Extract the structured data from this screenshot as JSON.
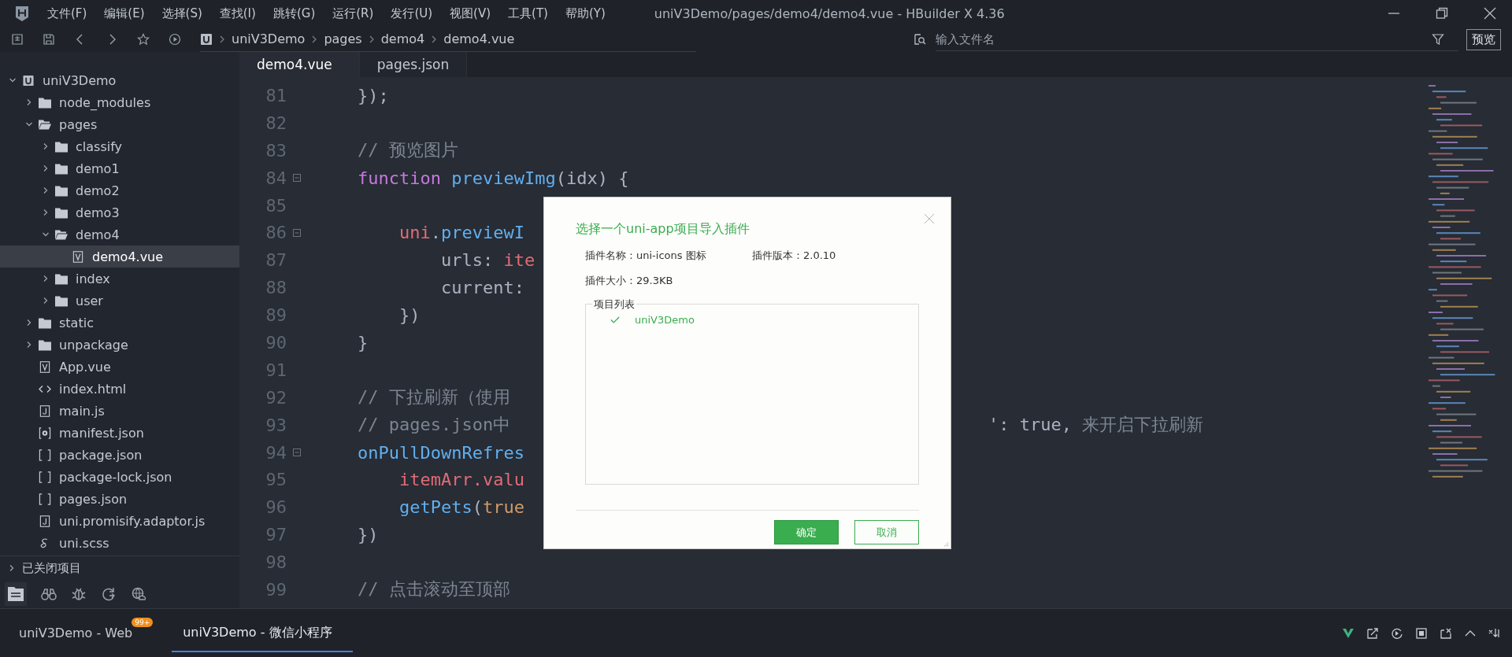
{
  "window": {
    "title": "uniV3Demo/pages/demo4/demo4.vue - HBuilder X 4.36"
  },
  "menu": [
    "文件(F)",
    "编辑(E)",
    "选择(S)",
    "查找(I)",
    "跳转(G)",
    "运行(R)",
    "发行(U)",
    "视图(V)",
    "工具(T)",
    "帮助(Y)"
  ],
  "breadcrumb": [
    "uniV3Demo",
    "pages",
    "demo4",
    "demo4.vue"
  ],
  "file_search": {
    "placeholder": "输入文件名"
  },
  "preview_button": "预览",
  "editor_tabs": [
    {
      "label": "demo4.vue",
      "selected": true
    },
    {
      "label": "pages.json",
      "selected": false
    }
  ],
  "tree": [
    {
      "label": "uniV3Demo",
      "kind": "project",
      "expanded": true,
      "selected": false,
      "children": [
        {
          "label": "node_modules",
          "kind": "folder",
          "expanded": false,
          "selected": false
        },
        {
          "label": "pages",
          "kind": "folder",
          "expanded": true,
          "selected": false,
          "children": [
            {
              "label": "classify",
              "kind": "folder",
              "expanded": false,
              "selected": false
            },
            {
              "label": "demo1",
              "kind": "folder",
              "expanded": false,
              "selected": false
            },
            {
              "label": "demo2",
              "kind": "folder",
              "expanded": false,
              "selected": false
            },
            {
              "label": "demo3",
              "kind": "folder",
              "expanded": false,
              "selected": false
            },
            {
              "label": "demo4",
              "kind": "folder",
              "expanded": true,
              "selected": false,
              "children": [
                {
                  "label": "demo4.vue",
                  "kind": "vue",
                  "selected": true
                }
              ]
            },
            {
              "label": "index",
              "kind": "folder",
              "expanded": false,
              "selected": false
            },
            {
              "label": "user",
              "kind": "folder",
              "expanded": false,
              "selected": false
            }
          ]
        },
        {
          "label": "static",
          "kind": "folder",
          "expanded": false,
          "selected": false
        },
        {
          "label": "unpackage",
          "kind": "folder",
          "expanded": false,
          "selected": false
        },
        {
          "label": "App.vue",
          "kind": "vue",
          "selected": false
        },
        {
          "label": "index.html",
          "kind": "html",
          "selected": false
        },
        {
          "label": "main.js",
          "kind": "js",
          "selected": false
        },
        {
          "label": "manifest.json",
          "kind": "settings",
          "selected": false
        },
        {
          "label": "package.json",
          "kind": "json",
          "selected": false
        },
        {
          "label": "package-lock.json",
          "kind": "json",
          "selected": false
        },
        {
          "label": "pages.json",
          "kind": "json",
          "selected": false
        },
        {
          "label": "uni.promisify.adaptor.js",
          "kind": "js",
          "selected": false
        },
        {
          "label": "uni.scss",
          "kind": "scss",
          "selected": false
        }
      ]
    }
  ],
  "closed_projects": {
    "label": "已关闭项目",
    "expanded": false
  },
  "code": [
    {
      "number": "81",
      "fold": false,
      "tokens": [
        {
          "text": "});",
          "kind": "plain"
        }
      ]
    },
    {
      "number": "82",
      "fold": false
    },
    {
      "number": "83",
      "fold": false,
      "tokens": [
        {
          "text": "// 预览图片",
          "kind": "comment"
        }
      ]
    },
    {
      "number": "84",
      "fold": true,
      "tokens": [
        {
          "text": "function ",
          "kind": "keyword"
        },
        {
          "text": "previewImg",
          "kind": "func"
        },
        {
          "text": "(idx) {",
          "kind": "plain"
        }
      ]
    },
    {
      "number": "85",
      "fold": false
    },
    {
      "number": "86",
      "fold": true,
      "tokens": [
        {
          "text": "    uni",
          "kind": "var"
        },
        {
          "text": ".",
          "kind": "plain"
        },
        {
          "text": "previewI",
          "kind": "func"
        }
      ]
    },
    {
      "number": "87",
      "fold": false,
      "tokens": [
        {
          "text": "        urls: ",
          "kind": "plain"
        },
        {
          "text": "ite",
          "kind": "var"
        }
      ]
    },
    {
      "number": "88",
      "fold": false,
      "tokens": [
        {
          "text": "        current:",
          "kind": "plain"
        }
      ]
    },
    {
      "number": "89",
      "fold": false,
      "tokens": [
        {
          "text": "    })",
          "kind": "plain"
        }
      ]
    },
    {
      "number": "90",
      "fold": false,
      "tokens": [
        {
          "text": "}",
          "kind": "plain"
        }
      ]
    },
    {
      "number": "91",
      "fold": false
    },
    {
      "number": "92",
      "fold": false,
      "tokens": [
        {
          "text": "// 下拉刷新（使用",
          "kind": "comment"
        }
      ]
    },
    {
      "number": "93",
      "fold": false,
      "tokens": [
        {
          "text": "// pages.json中",
          "kind": "comment"
        }
      ],
      "tail": [
        {
          "text": "': true, ",
          "kind": "plain"
        },
        {
          "text": "来开启下拉刷新",
          "kind": "comment"
        }
      ]
    },
    {
      "number": "94",
      "fold": true,
      "tokens": [
        {
          "text": "onPullDownRefres",
          "kind": "func"
        }
      ]
    },
    {
      "number": "95",
      "fold": false,
      "tokens": [
        {
          "text": "    itemArr.valu",
          "kind": "var"
        }
      ]
    },
    {
      "number": "96",
      "fold": false,
      "tokens": [
        {
          "text": "    getPets",
          "kind": "func"
        },
        {
          "text": "(",
          "kind": "plain"
        },
        {
          "text": "true",
          "kind": "bool"
        }
      ]
    },
    {
      "number": "97",
      "fold": false,
      "tokens": [
        {
          "text": "})",
          "kind": "plain"
        }
      ]
    },
    {
      "number": "98",
      "fold": false
    },
    {
      "number": "99",
      "fold": false,
      "tokens": [
        {
          "text": "// 点击滚动至顶部",
          "kind": "comment"
        }
      ]
    }
  ],
  "dialog": {
    "title": "选择一个uni-app项目导入插件",
    "plugin_name": "插件名称：uni-icons 图标",
    "plugin_version": "插件版本：2.0.10",
    "plugin_size": "插件大小：29.3KB",
    "list_legend": "项目列表",
    "projects": [
      {
        "label": "uniV3Demo",
        "checked": true
      }
    ],
    "buttons": [
      {
        "label": "确定",
        "kind": "primary"
      },
      {
        "label": "取消",
        "kind": "secondary"
      }
    ]
  },
  "console_tabs": [
    {
      "label": "uniV3Demo - Web",
      "badge": "99+",
      "selected": false
    },
    {
      "label": "uniV3Demo - 微信小程序",
      "selected": true
    }
  ]
}
